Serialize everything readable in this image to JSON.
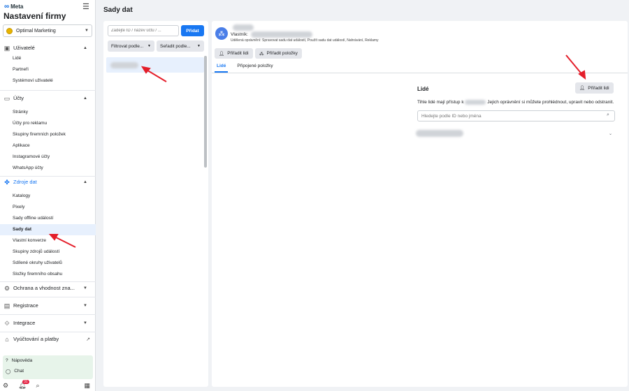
{
  "brand": {
    "logo_name": "Meta",
    "title": "Nastavení firmy"
  },
  "business": {
    "name": "Optimal Marketing"
  },
  "nav": {
    "users": {
      "label": "Uživatelé",
      "items": [
        "Lidé",
        "Partneři",
        "Systémoví uživatelé"
      ]
    },
    "accounts": {
      "label": "Účty",
      "items": [
        "Stránky",
        "Účty pro reklamu",
        "Skupiny firemních položek",
        "Aplikace",
        "Instagramové účty",
        "WhatsApp účty"
      ]
    },
    "data_sources": {
      "label": "Zdroje dat",
      "items": [
        "Katalogy",
        "Pixely",
        "Sady offline událostí",
        "Sady dat",
        "Vlastní konverze",
        "Skupiny zdrojů událostí",
        "Sdílené okruhy uživatelů",
        "Složky firemního obsahu"
      ]
    },
    "protection": {
      "label": "Ochrana a vhodnost zna..."
    },
    "registration": {
      "label": "Registrace"
    },
    "integrations": {
      "label": "Integrace"
    },
    "billing": {
      "label": "Vyúčtování a platby"
    }
  },
  "help": {
    "help_label": "Nápověda",
    "chat_label": "Chat",
    "notif_count": "31"
  },
  "page": {
    "title": "Sady dat"
  },
  "list": {
    "search_placeholder": "Zadejte ID / název účtu / ...",
    "add_label": "Přidat",
    "filter_label": "Filtrovat podle...",
    "sort_label": "Seřadit podle..."
  },
  "detail": {
    "owner_label": "Vlastník:",
    "permissions_text": "Udělená oprávnění: Spravovat sadu dat událostí, Použít sadu dat událostí, Nahrávání, Reklamy",
    "assign_people_label": "Přiřadit lidi",
    "assign_assets_label": "Přiřadit položky",
    "tabs": [
      "Lidé",
      "Připojené položky"
    ],
    "people_title": "Lidé",
    "people_assign_label": "Přiřadit lidi",
    "people_desc_prefix": "Tihle lidé mají přístup k",
    "people_desc_suffix": "Jejich oprávnění si můžete prohlédnout, upravit nebo odstranit.",
    "people_search_placeholder": "Hledejte podle ID nebo jména"
  },
  "colors": {
    "accent": "#1877f2",
    "annotation_arrow": "#e41e2a"
  }
}
